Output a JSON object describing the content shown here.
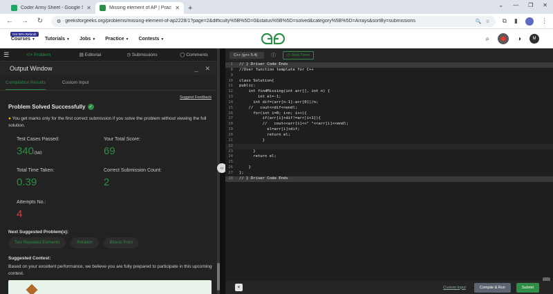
{
  "browser": {
    "tabs": [
      {
        "title": "Coder Army Sheet - Google She",
        "active": false,
        "favicon_color": "#1fa463"
      },
      {
        "title": "Missing element of AP | Practic",
        "active": true,
        "favicon_color": "#2f8d46"
      }
    ],
    "new_tab": "+",
    "url": "geeksforgeeks.org/problems/missing-element-of-ap2228/1?page=2&difficulty%5B%5D=0&status%5B%5D=solved&category%5B%5D=Arrays&sortBy=submissions",
    "profile_initial": ""
  },
  "site": {
    "sale_badge": "Get 90% Refund!",
    "menu": [
      "Courses",
      "Tutorials",
      "Jobs",
      "Practice",
      "Contests"
    ],
    "avatar_initial": "M",
    "brand_color": "#2f8d46"
  },
  "problem_tabs": [
    "Problem",
    "Editorial",
    "Submissions",
    "Comments"
  ],
  "output": {
    "title": "Output Window",
    "tabs": [
      "Compilation Results",
      "Custom Input"
    ],
    "feedback": "Suggest Feedback",
    "status": "Problem Solved Successfully",
    "note": "You get marks only for the first correct submission if you solve the problem without viewing the full solution.",
    "stats": {
      "test_cases_label": "Test Cases Passed:",
      "test_cases_value": "340",
      "test_cases_total": "/340",
      "score_label": "Your Total Score:",
      "score_value": "69",
      "time_label": "Total Time Taken:",
      "time_value": "0.39",
      "correct_label": "Correct Submission Count:",
      "correct_value": "2",
      "attempts_label": "Attempts No.:",
      "attempts_value": "4"
    },
    "next_label": "Next Suggested Problem(s):",
    "suggestions": [
      "Two Repeated Elements",
      "Rotation",
      "Bitonic Point"
    ],
    "contest_label": "Suggested Contest:",
    "contest_text": "Based on your excellent performance, we believe you are fully prepared to participate in this upcoming contest."
  },
  "editor": {
    "language": "C++ (g++ 5.4)",
    "timer": "Start Timer",
    "lines": [
      {
        "no": "1",
        "text": "// } Driver Code Ends",
        "cls": "cm",
        "gray": true
      },
      {
        "no": "8",
        "text": "//User function template for C++",
        "cls": "cm"
      },
      {
        "no": "9",
        "text": "",
        "cls": "tx"
      },
      {
        "no": "10",
        "text": "class Solution{",
        "cls": "tx"
      },
      {
        "no": "11",
        "text": "public:",
        "cls": "tx"
      },
      {
        "no": "12",
        "text": "    int findMissing(int arr[], int n) {",
        "cls": "tx"
      },
      {
        "no": "13",
        "text": "        int el=-1;",
        "cls": "tx"
      },
      {
        "no": "14",
        "text": "      int dif=(arr[n-1]-arr[0])/n;",
        "cls": "tx"
      },
      {
        "no": "15",
        "text": "    //   cout<<dif<<endl;",
        "cls": "cm"
      },
      {
        "no": "16",
        "text": "      for(int i=0; i<n; i++){",
        "cls": "tx"
      },
      {
        "no": "17",
        "text": "          if(arr[i]+dif!=arr[i+1]){",
        "cls": "tx"
      },
      {
        "no": "18",
        "text": "          //   cout<<arr[i]<<\" \"<<arr[i]<<endl;",
        "cls": "cm"
      },
      {
        "no": "19",
        "text": "            el=arr[i]+dif;",
        "cls": "tx"
      },
      {
        "no": "20",
        "text": "            return el;",
        "cls": "tx"
      },
      {
        "no": "21",
        "text": "          }",
        "cls": "tx"
      },
      {
        "no": "22",
        "text": "",
        "cls": "tx",
        "hl": true
      },
      {
        "no": "23",
        "text": "      }",
        "cls": "tx"
      },
      {
        "no": "24",
        "text": "      return el;",
        "cls": "tx"
      },
      {
        "no": "25",
        "text": "",
        "cls": "tx"
      },
      {
        "no": "26",
        "text": "    }",
        "cls": "tx"
      },
      {
        "no": "27",
        "text": "};",
        "cls": "tx"
      },
      {
        "no": "28",
        "text": "// } Driver Code Ends",
        "cls": "cm",
        "gray": true
      }
    ],
    "custom_input": "Custom Input",
    "compile": "Compile & Run",
    "submit": "Submit"
  }
}
